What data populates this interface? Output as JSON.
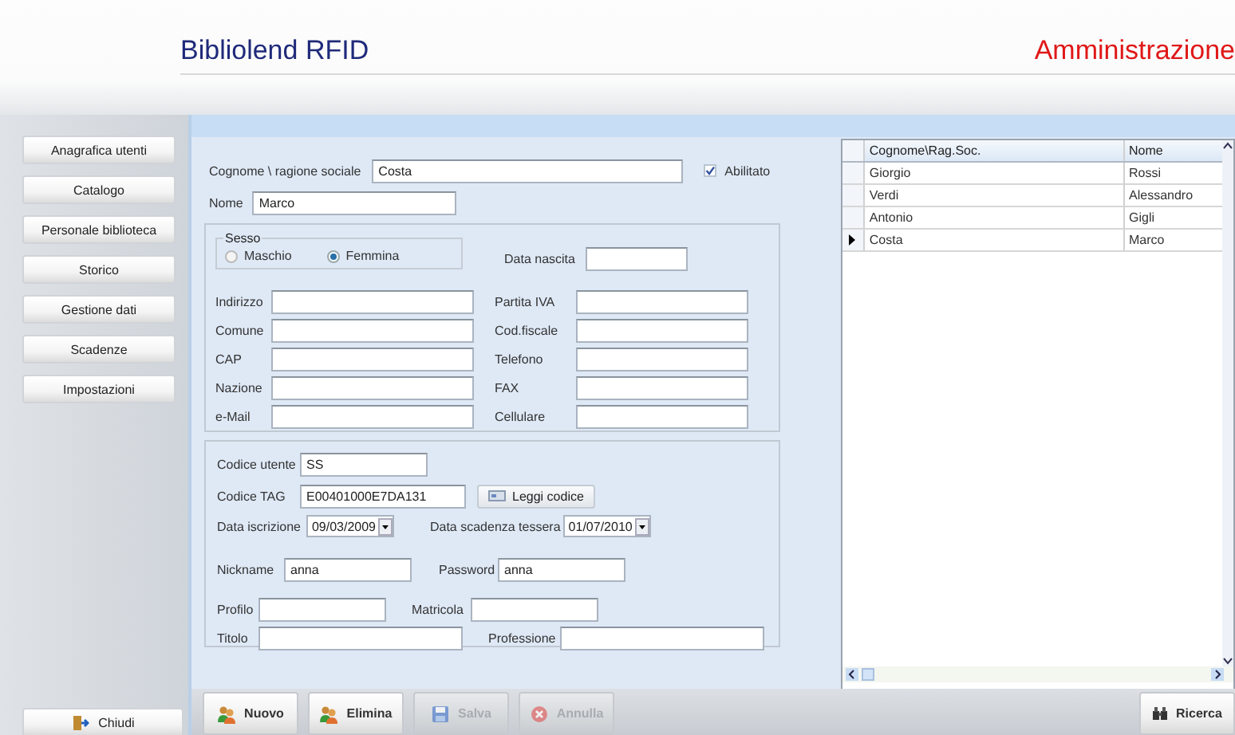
{
  "header": {
    "title": "Bibliolend RFID",
    "section": "Amministrazione"
  },
  "sidebar": {
    "items": [
      {
        "label": "Anagrafica utenti"
      },
      {
        "label": "Catalogo"
      },
      {
        "label": "Personale biblioteca"
      },
      {
        "label": "Storico"
      },
      {
        "label": "Gestione dati"
      },
      {
        "label": "Scadenze"
      },
      {
        "label": "Impostazioni"
      }
    ],
    "close_button": "Chiudi"
  },
  "form": {
    "surname": {
      "label": "Cognome \\ ragione sociale",
      "value": "Costa"
    },
    "enabled": {
      "label": "Abilitato",
      "checked": true
    },
    "name": {
      "label": "Nome",
      "value": "Marco"
    },
    "sex": {
      "legend": "Sesso",
      "options": [
        {
          "label": "Maschio",
          "selected": false
        },
        {
          "label": "Femmina",
          "selected": true
        }
      ]
    },
    "birth_date": {
      "label": "Data nascita"
    },
    "address_fields": [
      {
        "label": "Indirizzo"
      },
      {
        "label": "Comune"
      },
      {
        "label": "CAP"
      },
      {
        "label": "Nazione"
      },
      {
        "label": "e-Mail"
      }
    ],
    "contact_fields": [
      {
        "label": "Partita IVA"
      },
      {
        "label": "Cod.fiscale"
      },
      {
        "label": "Telefono"
      },
      {
        "label": "FAX"
      },
      {
        "label": "Cellulare"
      }
    ],
    "user_code": {
      "label": "Codice utente",
      "value": "SS"
    },
    "tag_code": {
      "label": "Codice TAG",
      "value": "E00401000E7DA131"
    },
    "read_button": "Leggi codice",
    "registration_date": {
      "label": "Data iscrizione",
      "value": "09/03/2009"
    },
    "expiry_date": {
      "label": "Data scadenza tessera",
      "value": "01/07/2010"
    },
    "nickname": {
      "label": "Nickname",
      "value": "anna"
    },
    "password": {
      "label": "Password",
      "value": "anna"
    },
    "profile": {
      "label": "Profilo"
    },
    "matricola": {
      "label": "Matricola"
    },
    "title": {
      "label": "Titolo"
    },
    "profession": {
      "label": "Professione"
    }
  },
  "grid": {
    "columns": [
      "Cognome\\Rag.Soc.",
      "Nome"
    ],
    "rows": [
      {
        "cells": [
          "Giorgio",
          "Rossi"
        ],
        "selected": false
      },
      {
        "cells": [
          "Verdi",
          "Alessandro"
        ],
        "selected": false
      },
      {
        "cells": [
          "Antonio",
          "Gigli"
        ],
        "selected": false
      },
      {
        "cells": [
          "Costa",
          "Marco"
        ],
        "selected": true
      }
    ]
  },
  "toolbar": {
    "buttons": [
      {
        "label": "Nuovo",
        "kind": "users",
        "disabled": false
      },
      {
        "label": "Elimina",
        "kind": "users",
        "disabled": false
      },
      {
        "label": "Salva",
        "kind": "save",
        "disabled": true
      },
      {
        "label": "Annulla",
        "kind": "cancel",
        "disabled": true
      }
    ],
    "search_button": "Ricerca"
  }
}
